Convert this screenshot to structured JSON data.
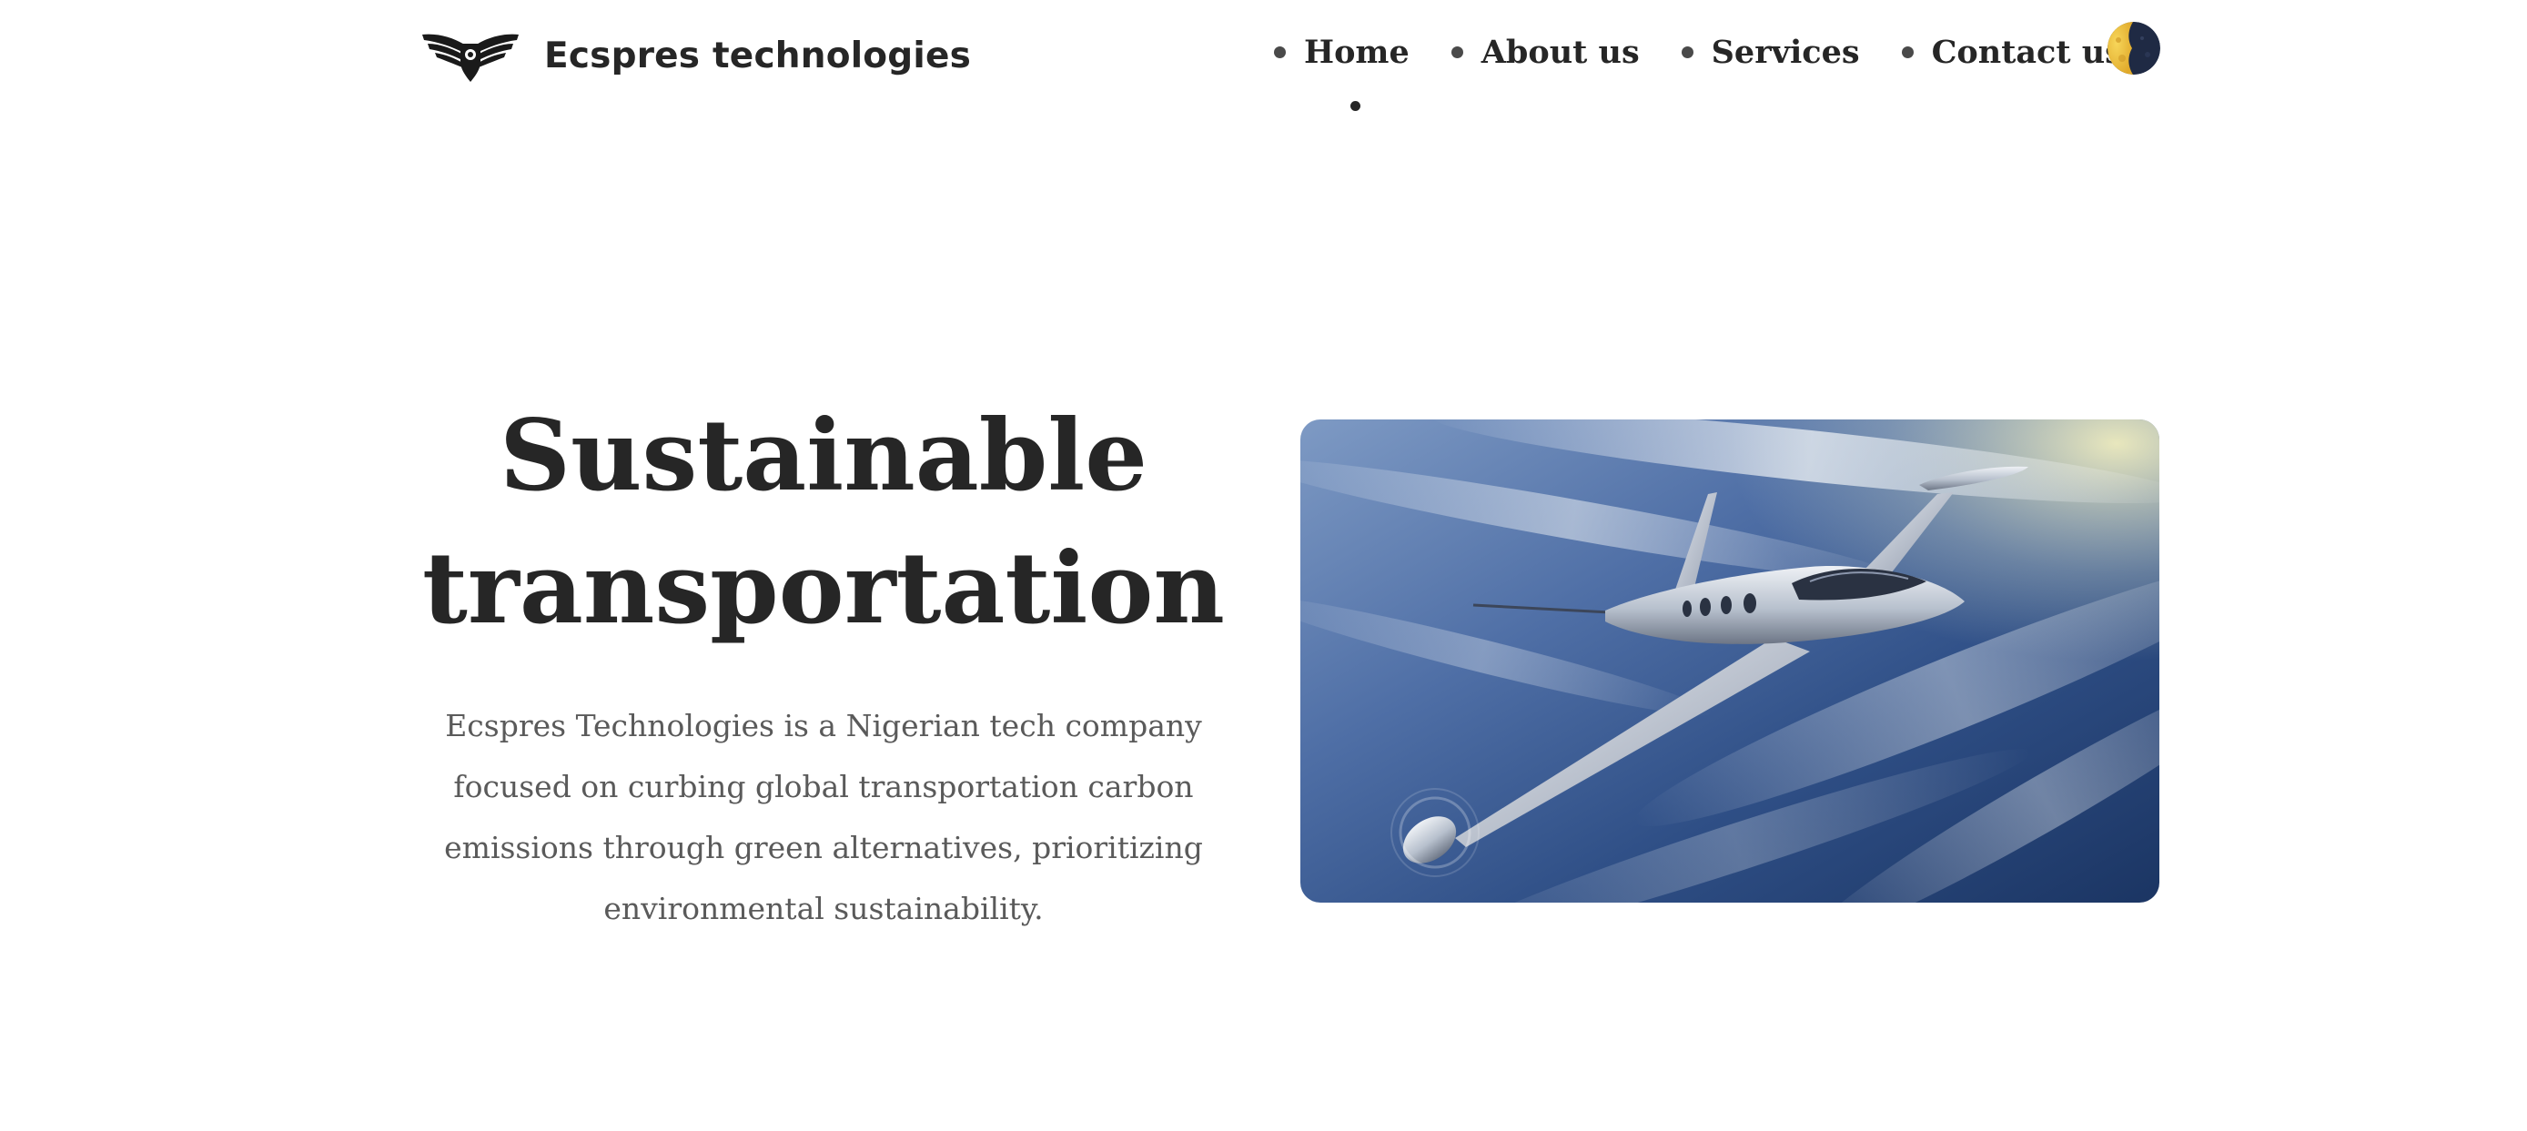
{
  "header": {
    "brand_name": "Ecspres technologies",
    "logo_icon": "winged-shield-logo-icon",
    "theme_toggle_icon": "half-moon-icon"
  },
  "nav": {
    "items": [
      {
        "label": "Home",
        "active": true
      },
      {
        "label": "About us",
        "active": false
      },
      {
        "label": "Services",
        "active": false
      },
      {
        "label": "Contact us",
        "active": false
      }
    ]
  },
  "hero": {
    "title_line_1": "Sustainable",
    "title_line_2": "transportation",
    "description": "Ecspres Technologies is a Nigerian tech company focused on curbing global transportation carbon emissions through green alternatives, prioritizing environmental sustainability.",
    "image_subject": "electric-aircraft-in-flight"
  },
  "colors": {
    "text_primary": "#262626",
    "text_secondary": "#5a5a5a",
    "background": "#ffffff",
    "toggle_sun": "#f2c744",
    "toggle_moon": "#1f2a44"
  }
}
